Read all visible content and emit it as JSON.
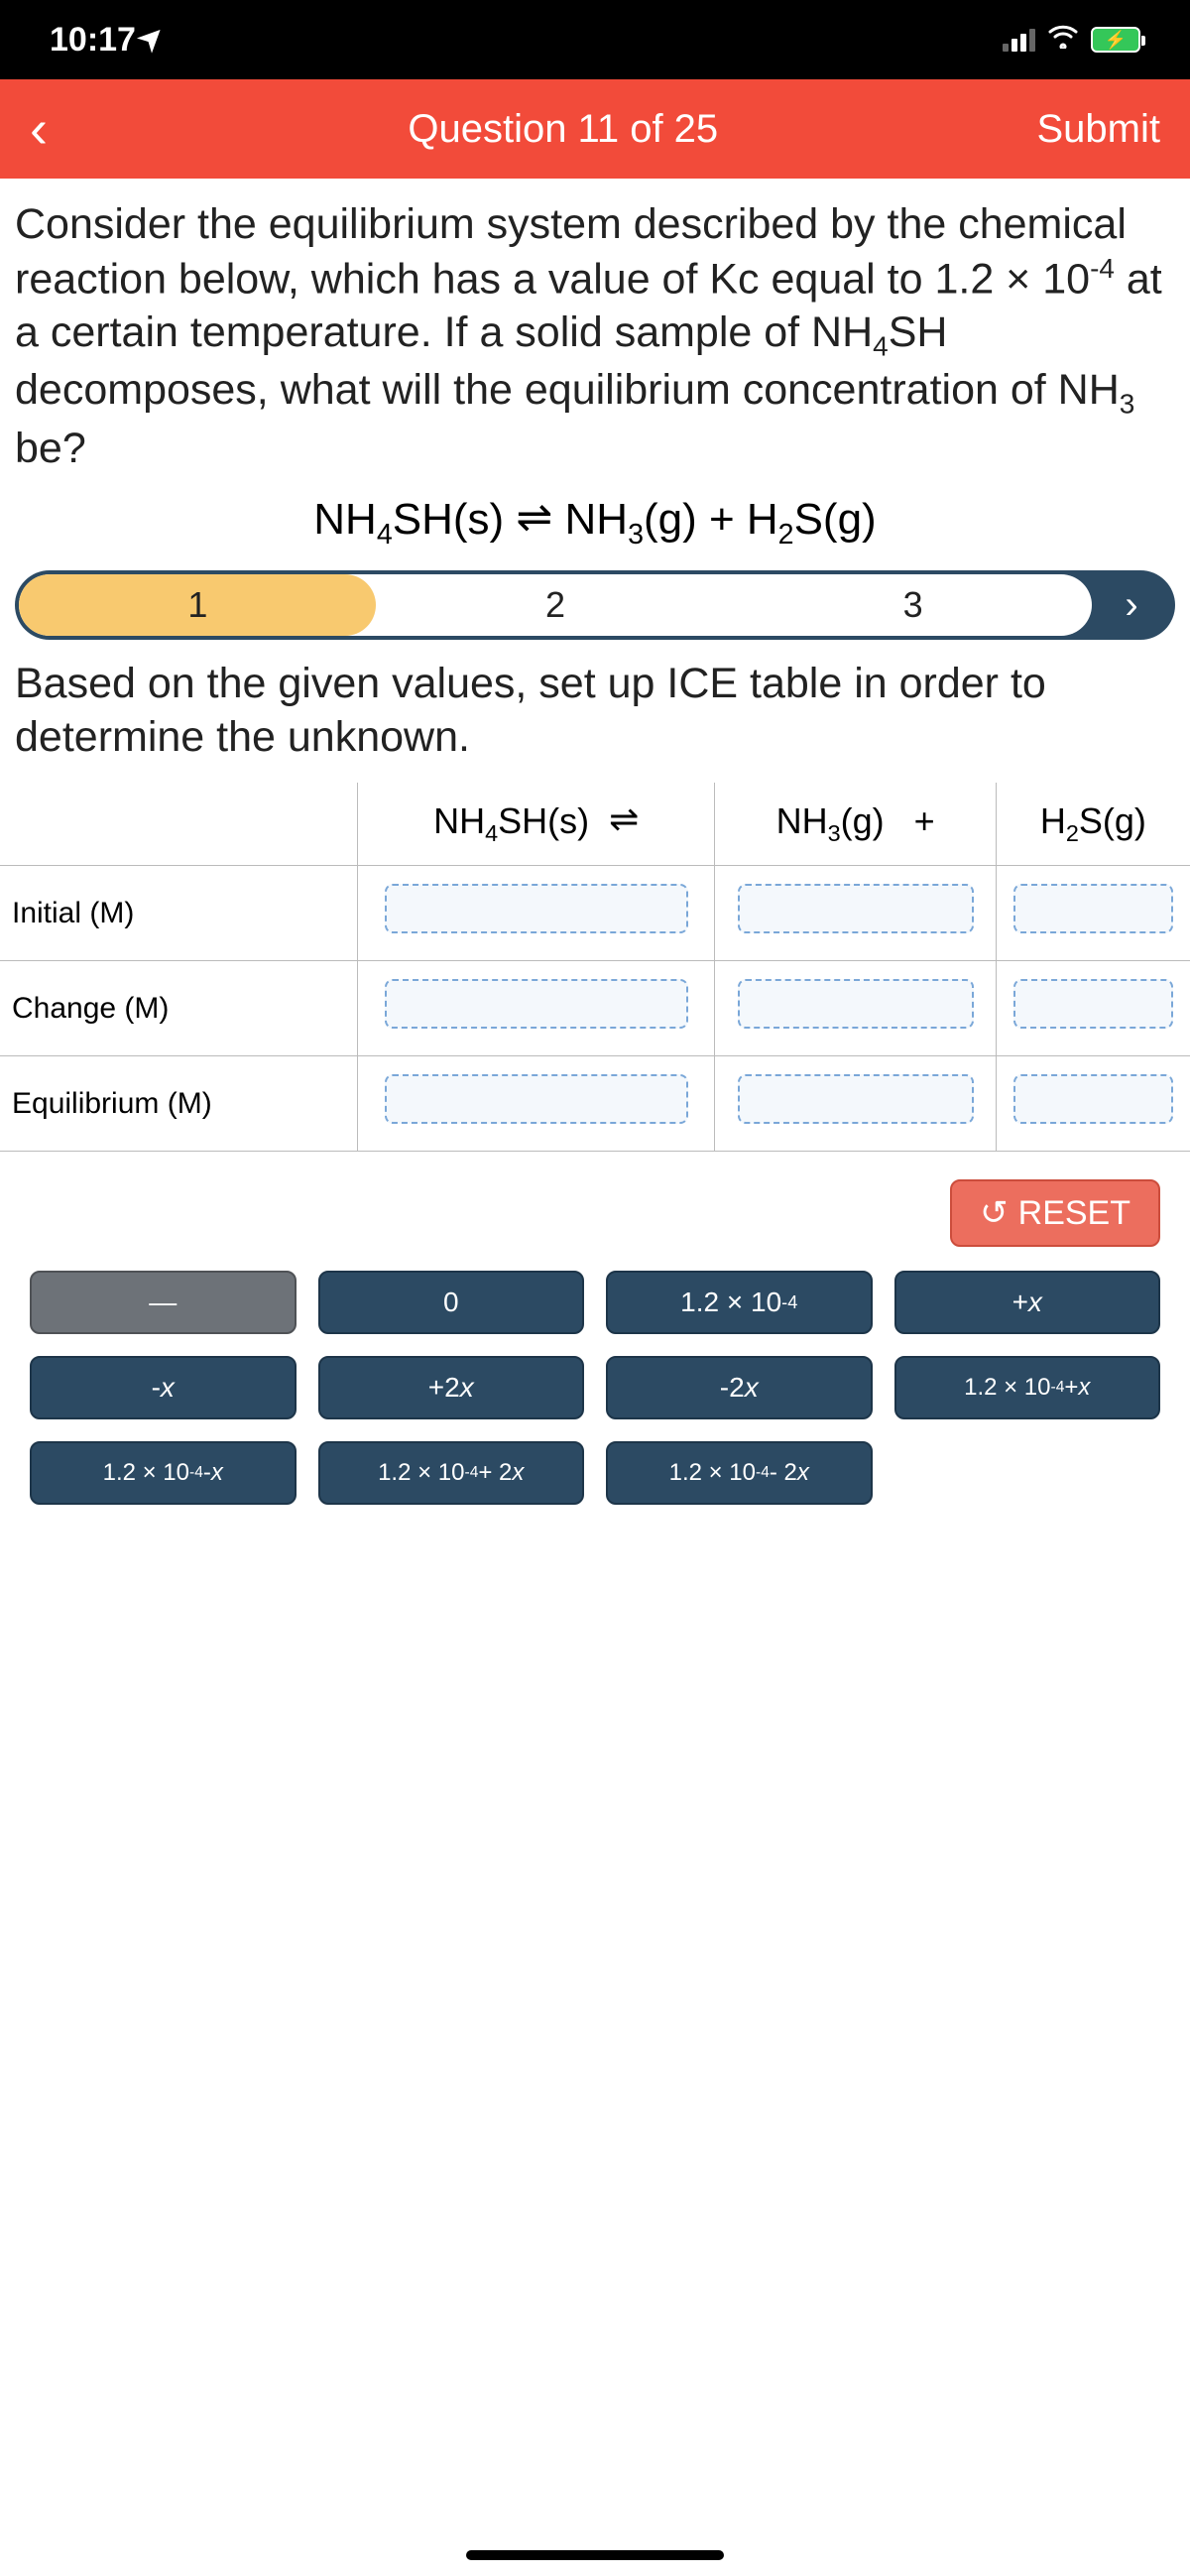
{
  "status": {
    "time": "10:17",
    "location_arrow": "➤"
  },
  "header": {
    "title": "Question 11 of 25",
    "submit": "Submit"
  },
  "question": {
    "text_html": "Consider the equilibrium system described by the chemical reaction below, which has a value of Kc equal to 1.2 × 10⁻⁴ at a certain temperature. If a solid sample of NH₄SH decomposes, what will the equilibrium concentration of NH₃ be?",
    "equation_html": "NH₄SH(s) ⇌ NH₃(g) + H₂S(g)"
  },
  "steps": {
    "items": [
      "1",
      "2",
      "3"
    ],
    "active_index": 0,
    "next_glyph": "›"
  },
  "instruction": "Based on the given values, set up ICE table in order to determine the unknown.",
  "table": {
    "col1": "NH₄SH(s)",
    "arrow": "⇌",
    "col2": "NH₃(g)",
    "plus": "+",
    "col3": "H₂S(g)",
    "rows": [
      "Initial (M)",
      "Change (M)",
      "Equilibrium (M)"
    ]
  },
  "reset": {
    "label": "RESET",
    "icon": "↺"
  },
  "chips": [
    {
      "label": "—",
      "dash": true
    },
    {
      "label": "0"
    },
    {
      "label_html": "1.2 × 10<sup>-4</sup>"
    },
    {
      "label_html": "+<span class='ital'>x</span>"
    },
    {
      "label_html": "-<span class='ital'>x</span>"
    },
    {
      "label_html": "+2<span class='ital'>x</span>"
    },
    {
      "label_html": "-2<span class='ital'>x</span>"
    },
    {
      "label_html": "1.2 × 10<sup>-4</sup> + <span class='ital'>x</span>"
    },
    {
      "label_html": "1.2 × 10<sup>-4</sup> - <span class='ital'>x</span>"
    },
    {
      "label_html": "1.2 × 10<sup>-4</sup> + 2<span class='ital'>x</span>"
    },
    {
      "label_html": "1.2 × 10<sup>-4</sup> - 2<span class='ital'>x</span>"
    }
  ]
}
